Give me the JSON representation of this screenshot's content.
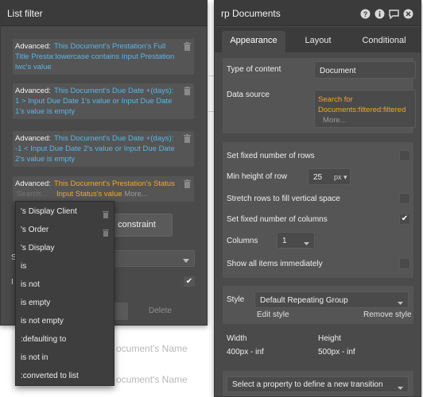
{
  "background": {
    "text1": "ocument's Name",
    "text2": "ocument's Name"
  },
  "list_filter": {
    "title": "List filter",
    "constraints": [
      {
        "advanced_label": "Advanced:",
        "expression": "This Document's Prestation's Full Title Presta:lowercase contains Input Prestation lwc's value"
      },
      {
        "advanced_label": "Advanced:",
        "expression": "This Document's Due Date +(days): 1 > Input Due Date 1's value or Input Due Date 1's value is empty"
      },
      {
        "advanced_label": "Advanced:",
        "expression": "This Document's Due Date +(days): -1 < Input Due Date 2's value or Input Due Date 2's value is empty"
      }
    ],
    "active_constraint": {
      "advanced_label": "Advanced:",
      "expression_line1": "This Document's Prestation's Status",
      "expression_line2": "Input Status's value",
      "search_placeholder": "Search...",
      "more_label": "More..."
    },
    "add_constraint_label": "constraint",
    "stub_s": "S",
    "stub_l": "I",
    "delete_label": "Delete",
    "dropdown_items": [
      {
        "label": "'s Display Client",
        "deletable": true
      },
      {
        "label": "'s Order",
        "deletable": true
      },
      {
        "label": "'s Display",
        "deletable": false
      },
      {
        "label": "is",
        "deletable": false
      },
      {
        "label": "is not",
        "deletable": false
      },
      {
        "label": "is empty",
        "deletable": false
      },
      {
        "label": "is not empty",
        "deletable": false
      },
      {
        "label": ":defaulting to",
        "deletable": false
      },
      {
        "label": "is not in",
        "deletable": false
      },
      {
        "label": ":converted to list",
        "deletable": false
      }
    ]
  },
  "rp": {
    "title": "rp Documents",
    "icons": [
      "help-icon",
      "info-icon",
      "comment-icon",
      "close-icon"
    ],
    "tabs": [
      "Appearance",
      "Layout",
      "Conditional"
    ],
    "active_tab": "Appearance",
    "type_of_content_label": "Type of content",
    "type_of_content_value": "Document",
    "data_source_label": "Data source",
    "data_source_line1": "Search for",
    "data_source_line2": "Documents:filtered:filtered",
    "data_source_more": "More...",
    "fixed_rows_label": "Set fixed number of rows",
    "fixed_rows_checked": false,
    "min_height_label": "Min height of row",
    "min_height_value": "25",
    "min_height_unit": "px",
    "stretch_rows_label": "Stretch rows to fill vertical space",
    "stretch_rows_checked": false,
    "fixed_columns_label": "Set fixed number of columns",
    "fixed_columns_checked": true,
    "columns_label": "Columns",
    "columns_value": "1",
    "show_all_label": "Show all items immediately",
    "show_all_checked": false,
    "style_label": "Style",
    "style_value": "Default Repeating Group",
    "edit_style_label": "Edit style",
    "remove_style_label": "Remove style",
    "width_label": "Width",
    "width_value": "400px - inf",
    "height_label": "Height",
    "height_value": "500px - inf",
    "transition_placeholder": "Select a property to define a new transition"
  },
  "colors": {
    "panel": "#4a4a4a",
    "header": "#3b3b3b",
    "expression_blue": "#5ab5e8",
    "expression_orange": "#f5a623"
  }
}
